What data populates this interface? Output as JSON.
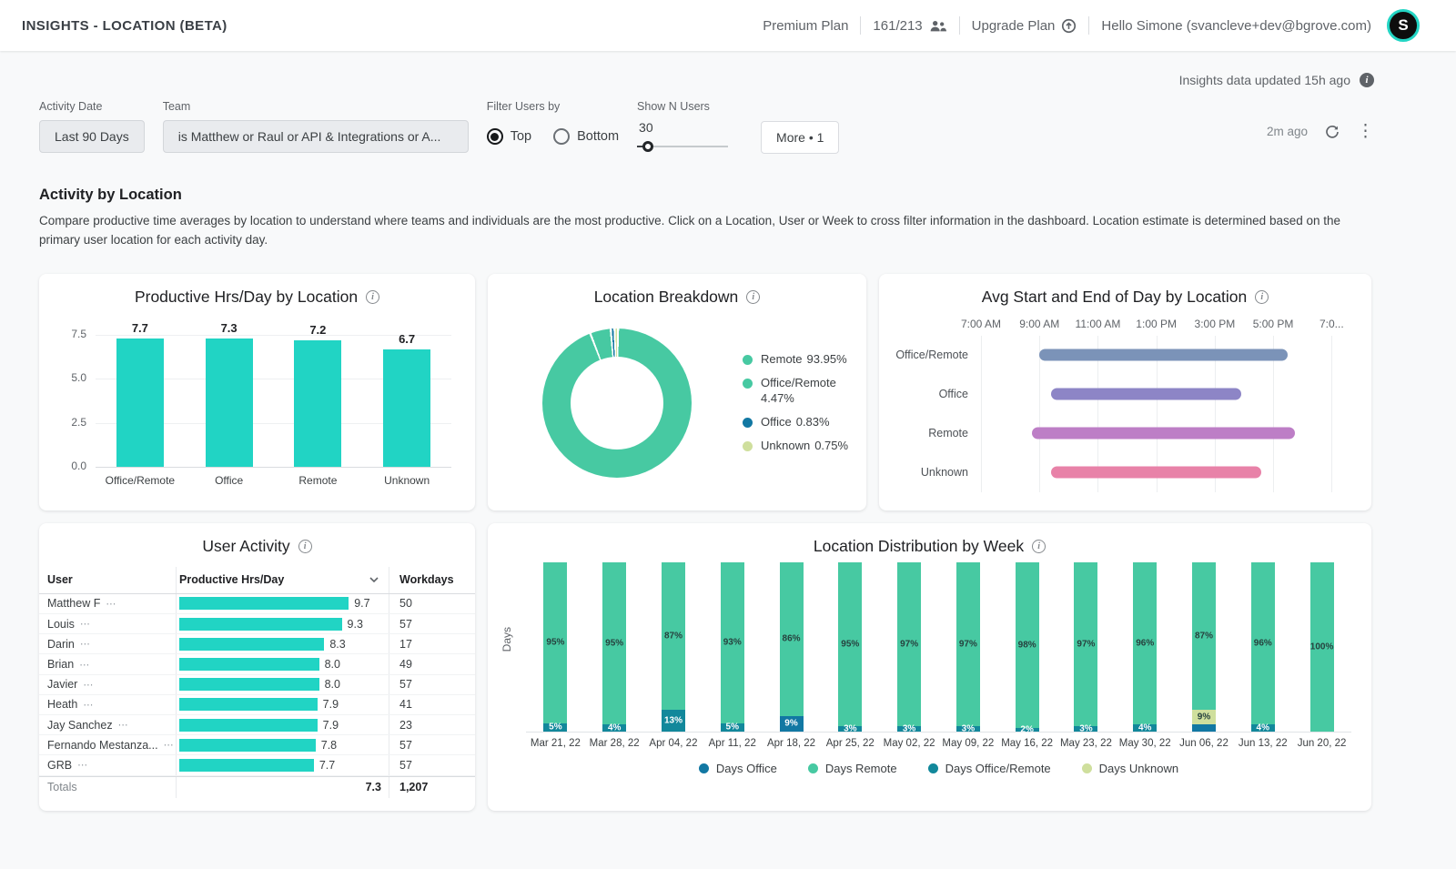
{
  "header": {
    "title": "INSIGHTS - LOCATION (BETA)",
    "plan_label": "Premium Plan",
    "usage": "161/213",
    "upgrade_label": "Upgrade Plan",
    "greeting": "Hello Simone (svancleve+dev@bgrove.com)",
    "avatar_initial": "S"
  },
  "meta": {
    "updated_note": "Insights data updated 15h ago",
    "refreshed_ago": "2m ago"
  },
  "filters": {
    "activity_date": {
      "label": "Activity Date",
      "value": "Last 90 Days"
    },
    "team": {
      "label": "Team",
      "value": "is Matthew or Raul or API & Integrations or A..."
    },
    "users_by": {
      "label": "Filter Users by",
      "options": [
        "Top",
        "Bottom"
      ],
      "selected": "Top"
    },
    "show_n": {
      "label": "Show N Users",
      "value": "30"
    },
    "more_label": "More • 1"
  },
  "section": {
    "title": "Activity by Location",
    "description": "Compare productive time averages by location to understand where teams and individuals are the most productive. Click on a Location, User or Week to cross filter information in the dashboard. Location estimate is determined based on the primary user location for each activity day."
  },
  "colors": {
    "accent": "#21d4c4",
    "green": "#47c9a2",
    "week_types": {
      "remote": "#47c9a2",
      "office": "#1278a3",
      "office_remote": "#12889b",
      "unknown": "#cfdf9d"
    },
    "gantt": {
      "office_remote": "#7b93b8",
      "office": "#8d85c6",
      "remote": "#bd7ec6",
      "unknown": "#e882a8"
    }
  },
  "charts": {
    "productive": {
      "type": "bar",
      "title": "Productive Hrs/Day by Location",
      "categories": [
        "Office/Remote",
        "Office",
        "Remote",
        "Unknown"
      ],
      "values": [
        7.7,
        7.3,
        7.2,
        6.7
      ],
      "yticks": [
        0,
        2.5,
        5,
        7.5
      ],
      "ymax": 8.3
    },
    "breakdown": {
      "type": "donut",
      "title": "Location Breakdown",
      "segments": [
        {
          "label": "Remote",
          "pct": 93.95,
          "pct_label": "93.95%",
          "color": "#47c9a2"
        },
        {
          "label": "Office/Remote",
          "pct": 4.47,
          "pct_label": "4.47%",
          "color": "#47c9a2"
        },
        {
          "label": "Office",
          "pct": 0.83,
          "pct_label": "0.83%",
          "color": "#1278a3"
        },
        {
          "label": "Unknown",
          "pct": 0.75,
          "pct_label": "0.75%",
          "color": "#cfdf9d"
        }
      ]
    },
    "start_end": {
      "type": "range",
      "title": "Avg Start and End of Day by Location",
      "axis_ticks": [
        "7:00 AM",
        "9:00 AM",
        "11:00 AM",
        "1:00 PM",
        "3:00 PM",
        "5:00 PM",
        "7:0..."
      ],
      "axis_min_hour": 7,
      "axis_max_hour": 19.8,
      "rows": [
        {
          "label": "Office/Remote",
          "key": "office_remote",
          "start_hour": 9.0,
          "end_hour": 17.5
        },
        {
          "label": "Office",
          "key": "office",
          "start_hour": 9.4,
          "end_hour": 15.9
        },
        {
          "label": "Remote",
          "key": "remote",
          "start_hour": 8.75,
          "end_hour": 17.75
        },
        {
          "label": "Unknown",
          "key": "unknown",
          "start_hour": 9.4,
          "end_hour": 16.6
        }
      ]
    },
    "user_activity": {
      "type": "table",
      "title": "User Activity",
      "columns": [
        "User",
        "Productive Hrs/Day",
        "Workdays"
      ],
      "rows": [
        {
          "user": "Matthew F",
          "hrs": "9.7",
          "workdays": "50"
        },
        {
          "user": "Louis",
          "hrs": "9.3",
          "workdays": "57"
        },
        {
          "user": "Darin",
          "hrs": "8.3",
          "workdays": "17"
        },
        {
          "user": "Brian",
          "hrs": "8.0",
          "workdays": "49"
        },
        {
          "user": "Javier",
          "hrs": "8.0",
          "workdays": "57"
        },
        {
          "user": "Heath",
          "hrs": "7.9",
          "workdays": "41"
        },
        {
          "user": "Jay Sanchez",
          "hrs": "7.9",
          "workdays": "23"
        },
        {
          "user": "Fernando Mestanza...",
          "hrs": "7.8",
          "workdays": "57"
        },
        {
          "user": "GRB",
          "hrs": "7.7",
          "workdays": "57"
        }
      ],
      "totals": {
        "label": "Totals",
        "hrs": "7.3",
        "workdays": "1,207"
      },
      "bar_scale_max": 10
    },
    "weekly": {
      "type": "stacked-bar",
      "title": "Location Distribution by Week",
      "ylabel": "Days",
      "weeks": [
        {
          "label": "Mar 21, 22",
          "remote_pct": 95,
          "remote_label": "95%",
          "segments": [
            {
              "type": "office_remote",
              "pct": 5,
              "label": "5%"
            }
          ]
        },
        {
          "label": "Mar 28, 22",
          "remote_pct": 95,
          "remote_label": "95%",
          "segments": [
            {
              "type": "office_remote",
              "pct": 4,
              "label": "4%"
            }
          ]
        },
        {
          "label": "Apr 04, 22",
          "remote_pct": 87,
          "remote_label": "87%",
          "segments": [
            {
              "type": "office_remote",
              "pct": 13,
              "label": "13%"
            }
          ]
        },
        {
          "label": "Apr 11, 22",
          "remote_pct": 93,
          "remote_label": "93%",
          "segments": [
            {
              "type": "office_remote",
              "pct": 5,
              "label": "5%"
            }
          ]
        },
        {
          "label": "Apr 18, 22",
          "remote_pct": 86,
          "remote_label": "86%",
          "segments": [
            {
              "type": "office",
              "pct": 9,
              "label": "9%"
            }
          ]
        },
        {
          "label": "Apr 25, 22",
          "remote_pct": 95,
          "remote_label": "95%",
          "segments": [
            {
              "type": "office_remote",
              "pct": 3,
              "label": "3%"
            }
          ]
        },
        {
          "label": "May 02, 22",
          "remote_pct": 97,
          "remote_label": "97%",
          "segments": [
            {
              "type": "office_remote",
              "pct": 3,
              "label": "3%"
            }
          ]
        },
        {
          "label": "May 09, 22",
          "remote_pct": 97,
          "remote_label": "97%",
          "segments": [
            {
              "type": "office_remote",
              "pct": 3,
              "label": "3%"
            }
          ]
        },
        {
          "label": "May 16, 22",
          "remote_pct": 98,
          "remote_label": "98%",
          "segments": [
            {
              "type": "office_remote",
              "pct": 2,
              "label": "2%"
            }
          ]
        },
        {
          "label": "May 23, 22",
          "remote_pct": 97,
          "remote_label": "97%",
          "segments": [
            {
              "type": "office_remote",
              "pct": 3,
              "label": "3%"
            }
          ]
        },
        {
          "label": "May 30, 22",
          "remote_pct": 96,
          "remote_label": "96%",
          "segments": [
            {
              "type": "office_remote",
              "pct": 4,
              "label": "4%"
            }
          ]
        },
        {
          "label": "Jun 06, 22",
          "remote_pct": 87,
          "remote_label": "87%",
          "segments": [
            {
              "type": "unknown",
              "pct": 9,
              "label": "9%"
            },
            {
              "type": "office",
              "pct": 4,
              "label": ""
            }
          ]
        },
        {
          "label": "Jun 13, 22",
          "remote_pct": 96,
          "remote_label": "96%",
          "segments": [
            {
              "type": "office_remote",
              "pct": 4,
              "label": "4%"
            }
          ]
        },
        {
          "label": "Jun 20, 22",
          "remote_pct": 100,
          "remote_label": "100%",
          "segments": []
        }
      ],
      "legend": [
        {
          "label": "Days Office",
          "type": "office"
        },
        {
          "label": "Days Remote",
          "type": "remote"
        },
        {
          "label": "Days Office/Remote",
          "type": "office_remote"
        },
        {
          "label": "Days Unknown",
          "type": "unknown"
        }
      ]
    }
  }
}
